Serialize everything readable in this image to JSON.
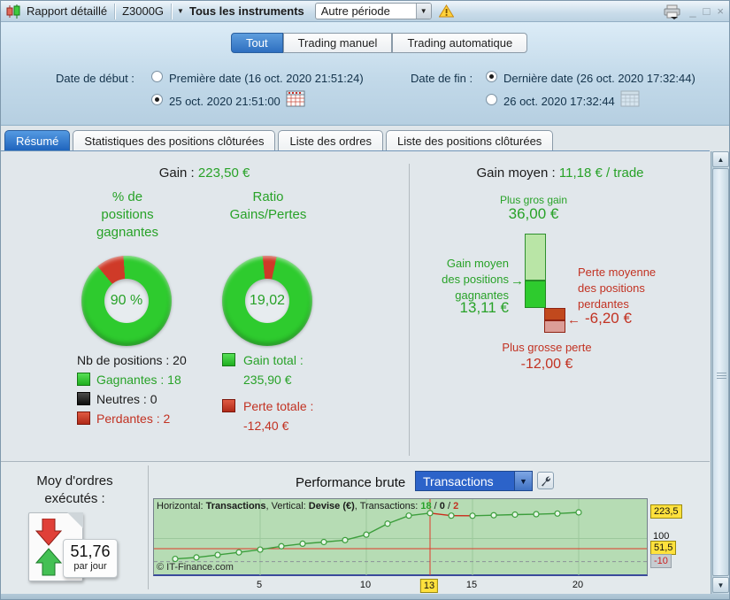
{
  "window": {
    "app_title": "Rapport détaillé",
    "instrument": "Z3000G",
    "instrument_selector": "Tous les instruments",
    "period_dropdown_value": "Autre période",
    "minimize": "_",
    "maximize": "□",
    "close": "×"
  },
  "filters": {
    "mode_tabs": [
      {
        "label": "Tout",
        "selected": true
      },
      {
        "label": "Trading manuel",
        "selected": false
      },
      {
        "label": "Trading automatique",
        "selected": false
      }
    ],
    "start": {
      "label": "Date de début :",
      "option1": "Première date (16 oct. 2020 21:51:24)",
      "option2": "25 oct. 2020 21:51:00",
      "selected_option": 2
    },
    "end": {
      "label": "Date de fin :",
      "option1": "Dernière date (26 oct. 2020 17:32:44)",
      "option2": "26 oct. 2020 17:32:44",
      "selected_option": 1
    }
  },
  "tabs": [
    {
      "label": "Résumé",
      "active": true
    },
    {
      "label": "Statistiques des positions clôturées",
      "active": false
    },
    {
      "label": "Liste des ordres",
      "active": false
    },
    {
      "label": "Liste des positions clôturées",
      "active": false
    }
  ],
  "summary": {
    "gain_label": "Gain :",
    "gain_value": "223,50 €",
    "winrate": {
      "title_lines": [
        "% de",
        "positions",
        "gagnantes"
      ],
      "value_text": "90 %"
    },
    "ratio": {
      "title_lines": [
        "Ratio",
        "Gains/Pertes"
      ],
      "value_text": "19,02"
    },
    "donuts": [
      {
        "red_fraction": 0.1,
        "red_start_deg": -40
      },
      {
        "red_fraction": 0.05,
        "red_start_deg": -6
      }
    ],
    "colors": {
      "green": "#2ecb2e",
      "red": "#cf3a28",
      "green_dark": "#1fa31f"
    },
    "positions_label": "Nb de positions : 20",
    "legend": [
      {
        "label": "Gagnantes : 18",
        "square": "green",
        "text_class": "green"
      },
      {
        "label": "Neutres : 0",
        "square": "dark",
        "text_class": "blk"
      },
      {
        "label": "Perdantes : 2",
        "square": "red",
        "text_class": "red"
      }
    ],
    "totals": [
      {
        "label": "Gain total :",
        "value": "235,90 €",
        "square": "green",
        "text_class": "green"
      },
      {
        "label": "Perte totale :",
        "value": "-12,40 €",
        "square": "red",
        "text_class": "red"
      }
    ]
  },
  "average": {
    "label": "Gain moyen :",
    "value": "11,18 € / trade"
  },
  "distribution": {
    "max_gain": {
      "label": "Plus gros gain",
      "value": "36,00 €",
      "num": 36
    },
    "avg_gain": {
      "label_lines": [
        "Gain moyen",
        "des positions",
        "gagnantes"
      ],
      "value": "13,11 €",
      "num": 13.11
    },
    "avg_loss": {
      "label_lines": [
        "Perte moyenne",
        "des positions",
        "perdantes"
      ],
      "value": "-6,20 €",
      "num": -6.2
    },
    "max_loss": {
      "label": "Plus grosse perte",
      "value": "-12,00 €",
      "num": -12
    }
  },
  "orders": {
    "title_lines": [
      "Moy d'ordres",
      "exécutés :"
    ],
    "value": "51,76",
    "unit": "par jour"
  },
  "performance": {
    "label": "Performance brute",
    "dropdown_value": "Transactions"
  },
  "chart_data": {
    "type": "line",
    "header": {
      "p1": "Horizontal: ",
      "h_label": "Transactions",
      "p2": ", Vertical: ",
      "v_label": "Devise (€)",
      "p3": ", Transactions: ",
      "wins": "18",
      "sep1": " / ",
      "neutral": "0",
      "sep2": " / ",
      "losses": "2"
    },
    "x": [
      1,
      2,
      3,
      4,
      5,
      6,
      7,
      8,
      9,
      10,
      11,
      12,
      13,
      14,
      15,
      16,
      17,
      18,
      19,
      20
    ],
    "series": [
      {
        "name": "Performance brute cumulée (€)",
        "values": [
          3,
          10,
          22,
          34,
          47,
          63,
          75,
          83,
          92,
          118,
          170,
          208,
          220,
          208,
          207.6,
          210,
          213,
          215,
          218,
          223.5
        ]
      }
    ],
    "xlabel": "Transactions",
    "ylabel": "Devise (€)",
    "y_range_shown": [
      -10,
      223.5
    ],
    "x_ticks": [
      5,
      10,
      15,
      20
    ],
    "grid_y_values": [
      100
    ],
    "dashed_baseline": -10,
    "crosshair": {
      "x": 13,
      "y": 51.5
    },
    "x_labels": [
      {
        "t": 5,
        "text": "5",
        "style": "plain"
      },
      {
        "t": 10,
        "text": "10",
        "style": "plain"
      },
      {
        "t": 13,
        "text": "13",
        "style": "yellow"
      },
      {
        "t": 15,
        "text": "15",
        "style": "plain"
      },
      {
        "t": 20,
        "text": "20",
        "style": "plain"
      }
    ],
    "y_labels": [
      {
        "v": 223.5,
        "text": "223,5",
        "style": "yellow"
      },
      {
        "v": 100,
        "text": "100",
        "style": "plain"
      },
      {
        "v": 51.5,
        "text": "51,5",
        "style": "yellow"
      },
      {
        "v": -10,
        "text": "-10",
        "style": "grayred"
      }
    ],
    "line_color": "#3c9e3c",
    "loss_color": "#cc2a1a",
    "copyright": "© IT-Finance.com"
  }
}
